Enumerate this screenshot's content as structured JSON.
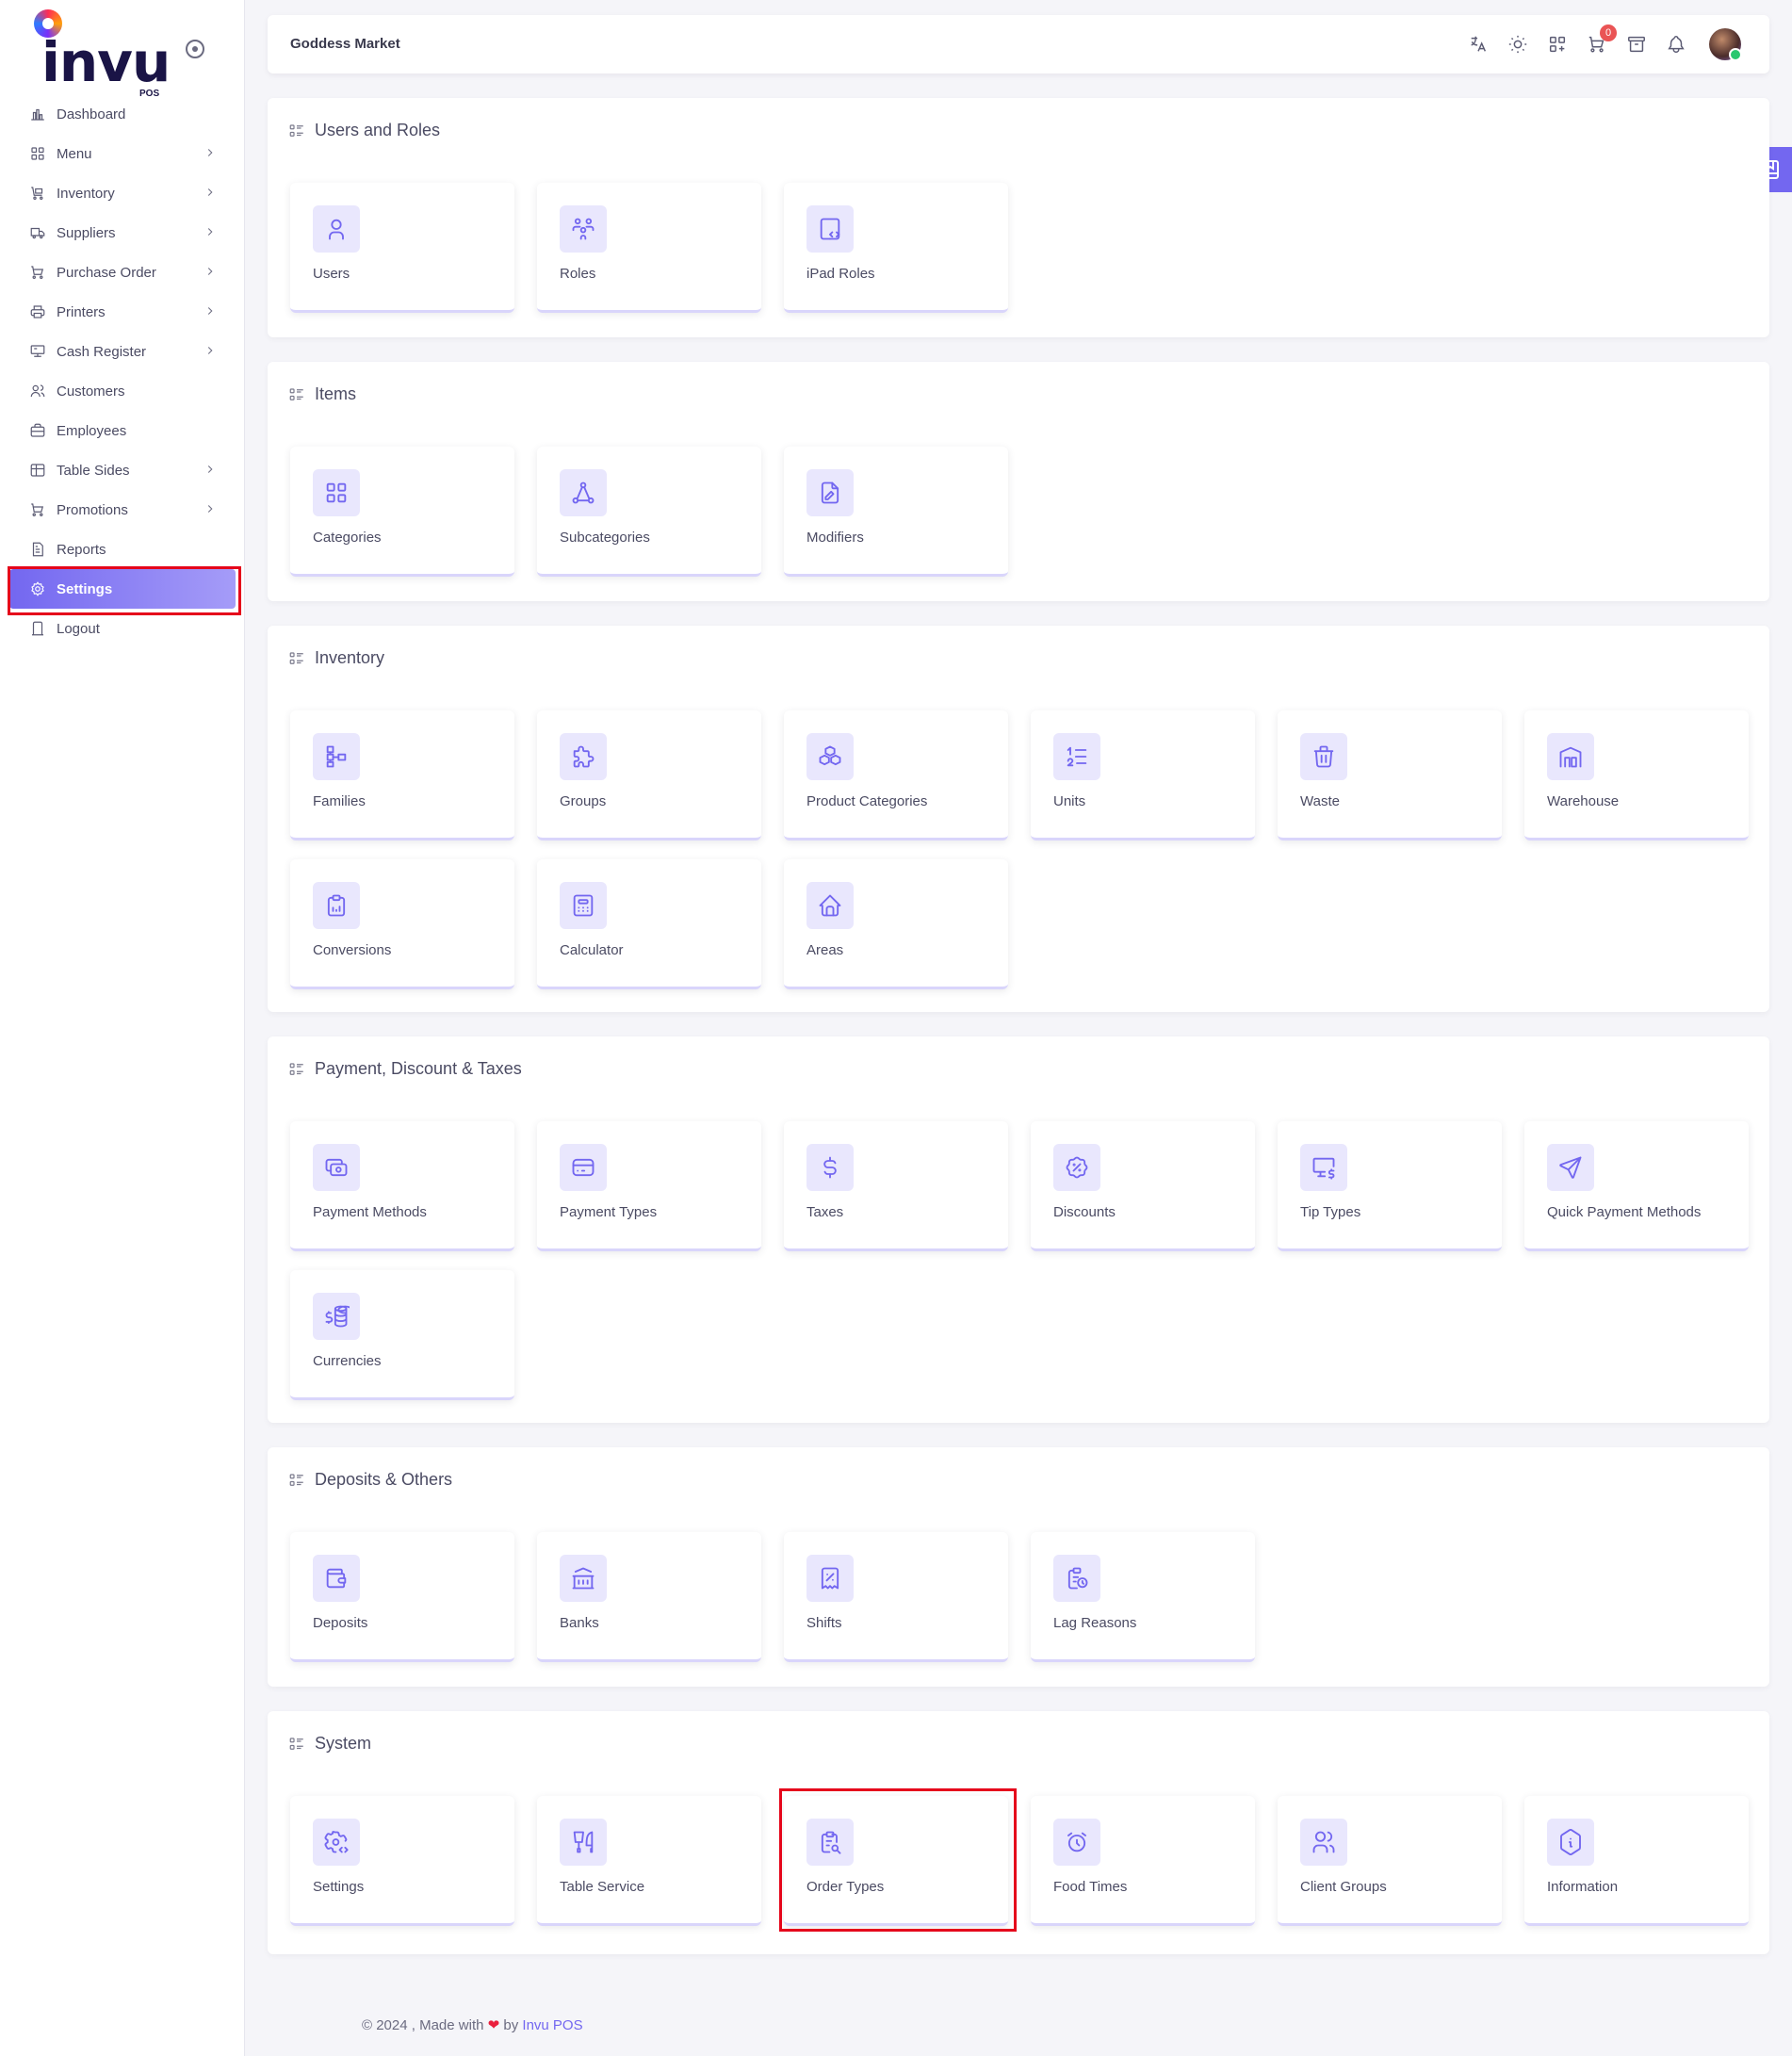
{
  "app": {
    "logo_text": "invu",
    "logo_sub": "POS",
    "store_name": "Goddess Market"
  },
  "sidebar": {
    "items": [
      {
        "label": "Dashboard",
        "icon": "chart-bar-icon",
        "chevron": false
      },
      {
        "label": "Menu",
        "icon": "grid-icon",
        "chevron": true
      },
      {
        "label": "Inventory",
        "icon": "cart-box-icon",
        "chevron": true
      },
      {
        "label": "Suppliers",
        "icon": "truck-icon",
        "chevron": true
      },
      {
        "label": "Purchase Order",
        "icon": "shopping-cart-icon",
        "chevron": true
      },
      {
        "label": "Printers",
        "icon": "printer-icon",
        "chevron": true
      },
      {
        "label": "Cash Register",
        "icon": "register-icon",
        "chevron": true
      },
      {
        "label": "Customers",
        "icon": "users-icon",
        "chevron": false
      },
      {
        "label": "Employees",
        "icon": "briefcase-icon",
        "chevron": false
      },
      {
        "label": "Table Sides",
        "icon": "table-icon",
        "chevron": true
      },
      {
        "label": "Promotions",
        "icon": "shopping-cart-icon",
        "chevron": true
      },
      {
        "label": "Reports",
        "icon": "report-icon",
        "chevron": false
      },
      {
        "label": "Settings",
        "icon": "gear-icon",
        "chevron": false,
        "active": true
      },
      {
        "label": "Logout",
        "icon": "logout-icon",
        "chevron": false
      }
    ]
  },
  "navbar": {
    "cart_count": "0"
  },
  "sections": [
    {
      "title": "Users and Roles",
      "cards": [
        {
          "label": "Users",
          "icon": "user"
        },
        {
          "label": "Roles",
          "icon": "roles"
        },
        {
          "label": "iPad Roles",
          "icon": "ipad"
        }
      ]
    },
    {
      "title": "Items",
      "cards": [
        {
          "label": "Categories",
          "icon": "grid"
        },
        {
          "label": "Subcategories",
          "icon": "hierarchy"
        },
        {
          "label": "Modifiers",
          "icon": "file-edit"
        }
      ]
    },
    {
      "title": "Inventory",
      "cards": [
        {
          "label": "Families",
          "icon": "tree"
        },
        {
          "label": "Groups",
          "icon": "puzzle"
        },
        {
          "label": "Product Categories",
          "icon": "boxes"
        },
        {
          "label": "Units",
          "icon": "list-numbers"
        },
        {
          "label": "Waste",
          "icon": "trash"
        },
        {
          "label": "Warehouse",
          "icon": "warehouse"
        },
        {
          "label": "Conversions",
          "icon": "clipboard-chart"
        },
        {
          "label": "Calculator",
          "icon": "calculator"
        },
        {
          "label": "Areas",
          "icon": "home"
        }
      ]
    },
    {
      "title": "Payment, Discount & Taxes",
      "cards": [
        {
          "label": "Payment Methods",
          "icon": "cash"
        },
        {
          "label": "Payment Types",
          "icon": "credit-card"
        },
        {
          "label": "Taxes",
          "icon": "dollar"
        },
        {
          "label": "Discounts",
          "icon": "discount"
        },
        {
          "label": "Tip Types",
          "icon": "monitor-dollar"
        },
        {
          "label": "Quick Payment Methods",
          "icon": "send"
        },
        {
          "label": "Currencies",
          "icon": "coins"
        }
      ]
    },
    {
      "title": "Deposits & Others",
      "cards": [
        {
          "label": "Deposits",
          "icon": "wallet"
        },
        {
          "label": "Banks",
          "icon": "bank"
        },
        {
          "label": "Shifts",
          "icon": "receipt-percent"
        },
        {
          "label": "Lag Reasons",
          "icon": "clipboard-clock"
        }
      ]
    },
    {
      "title": "System",
      "cards": [
        {
          "label": "Settings",
          "icon": "settings-code"
        },
        {
          "label": "Table Service",
          "icon": "tools-kitchen"
        },
        {
          "label": "Order Types",
          "icon": "clipboard-search",
          "highlight": true
        },
        {
          "label": "Food Times",
          "icon": "alarm"
        },
        {
          "label": "Client Groups",
          "icon": "users"
        },
        {
          "label": "Information",
          "icon": "info-hex"
        }
      ]
    }
  ],
  "footer": {
    "prefix": "© 2024 , Made with",
    "heart": "❤",
    "by": "by",
    "brand": "Invu POS"
  }
}
